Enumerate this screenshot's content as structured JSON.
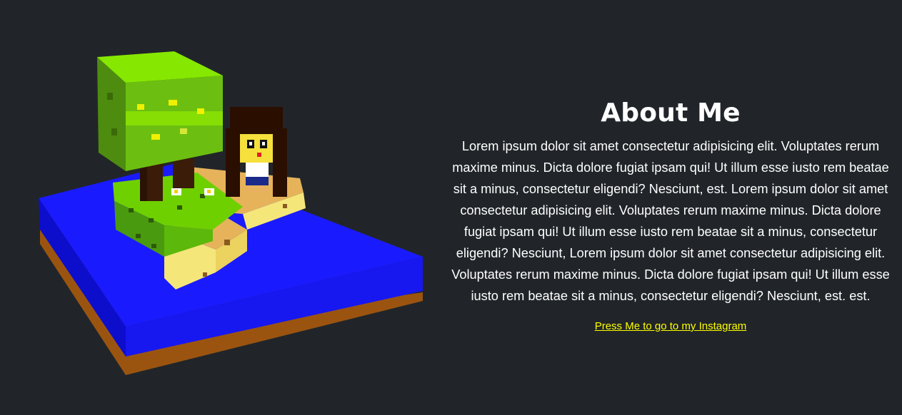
{
  "about": {
    "heading": "About Me",
    "body": "Lorem ipsum dolor sit amet consectetur adipisicing elit. Voluptates rerum maxime minus. Dicta dolore fugiat ipsam qui! Ut illum esse iusto rem beatae sit a minus, consectetur eligendi? Nesciunt, est. Lorem ipsum dolor sit amet consectetur adipisicing elit. Voluptates rerum maxime minus. Dicta dolore fugiat ipsam qui! Ut illum esse iusto rem beatae sit a minus, consectetur eligendi? Nesciunt, Lorem ipsum dolor sit amet consectetur adipisicing elit. Voluptates rerum maxime minus. Dicta dolore fugiat ipsam qui! Ut illum esse iusto rem beatae sit a minus, consectetur eligendi? Nesciunt, est. est.",
    "link_label": "Press Me to go to my Instagram"
  },
  "colors": {
    "background": "#212529",
    "text": "#ffffff",
    "link": "#ffff00",
    "water": "#1a1aff",
    "soil": "#a05a10",
    "grass": "#7cdc00",
    "sand": "#f0e070"
  }
}
